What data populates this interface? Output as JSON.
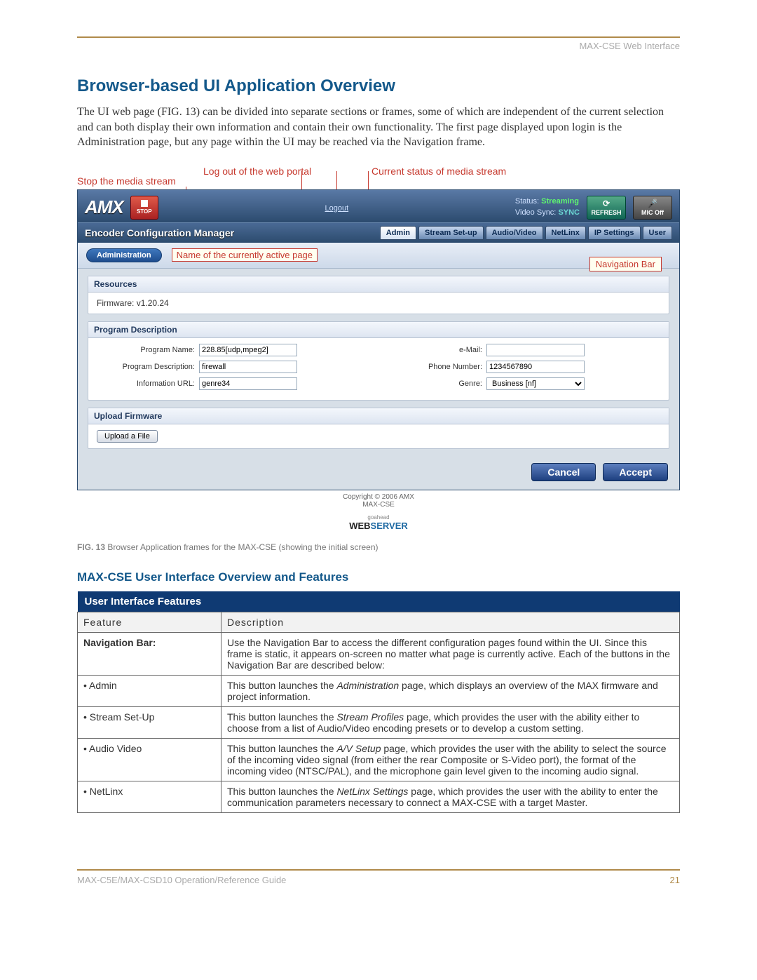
{
  "header_right": "MAX-CSE Web Interface",
  "title": "Browser-based UI Application Overview",
  "body_para": "The UI web page (FIG. 13) can be divided into separate sections or frames, some of which are independent of the current selection and can both display their own information and contain their own functionality. The first page displayed upon login is the Administration page, but any page within the UI may be reached via the Navigation frame.",
  "callouts": {
    "stop": "Stop the media stream",
    "logout": "Log out of the web portal",
    "status": "Current status of media stream",
    "active_page": "Name of the currently active page",
    "navbar": "Navigation Bar"
  },
  "app": {
    "logo": "AMX",
    "stop_label": "STOP",
    "logout_link": "Logout",
    "status": {
      "status_lbl": "Status:",
      "status_val": "Streaming",
      "vsync_lbl": "Video Sync:",
      "vsync_val": "SYNC"
    },
    "refresh_btn": "REFRESH",
    "mic_btn": "MIC Off",
    "ecm_title": "Encoder Configuration Manager",
    "tabs": [
      "Admin",
      "Stream Set-up",
      "Audio/Video",
      "NetLinx",
      "IP Settings",
      "User"
    ],
    "crumb": "Administration",
    "panels": {
      "resources": {
        "title": "Resources",
        "firmware_lbl": "Firmware:",
        "firmware_val": "v1.20.24"
      },
      "program": {
        "title": "Program Description",
        "prog_name_lbl": "Program Name:",
        "prog_name_val": "228.85[udp,mpeg2]",
        "prog_desc_lbl": "Program Description:",
        "prog_desc_val": "firewall",
        "info_url_lbl": "Information URL:",
        "info_url_val": "genre34",
        "email_lbl": "e-Mail:",
        "email_val": "",
        "phone_lbl": "Phone Number:",
        "phone_val": "1234567890",
        "genre_lbl": "Genre:",
        "genre_val": "Business [nf]"
      },
      "upload": {
        "title": "Upload Firmware",
        "button": "Upload a File"
      }
    },
    "cancel": "Cancel",
    "accept": "Accept",
    "copyright": "Copyright © 2006 AMX",
    "copyright2": "MAX-CSE",
    "webserver_tiny": "goahead",
    "webserver1": "WEB",
    "webserver2": "SERVER"
  },
  "fig_caption_bold": "FIG. 13",
  "fig_caption": "Browser Application frames for the MAX-CSE (showing the initial screen)",
  "subhead": "MAX-CSE User Interface Overview and Features",
  "table": {
    "bar": "User Interface Features",
    "col1": "Feature",
    "col2": "Description",
    "rows": [
      {
        "feature": "Navigation Bar:",
        "feature_bold": true,
        "desc": "Use the Navigation Bar to access the different configuration pages found within the UI. Since this frame is static, it appears on-screen no matter what page is currently active. Each of the buttons in the Navigation Bar are described below:"
      },
      {
        "feature": "• Admin",
        "desc_html": "This button launches the <em>Administration</em> page, which displays an overview of the MAX firmware and project information."
      },
      {
        "feature": "• Stream Set-Up",
        "desc_html": "This button launches the <em>Stream Profiles</em> page, which provides the user with the ability either to choose from a list of Audio/Video encoding presets or to develop a custom setting."
      },
      {
        "feature": "• Audio Video",
        "desc_html": "This button launches the <em>A/V Setup</em> page, which provides the user with the ability to select the source of the incoming video signal (from either the rear Composite or S-Video port), the format of the incoming video (NTSC/PAL), and the microphone gain level given to the incoming audio signal."
      },
      {
        "feature": "• NetLinx",
        "desc_html": "This button launches the <em>NetLinx Settings</em> page, which provides the user with the ability to enter the communication parameters necessary to connect a MAX-CSE with a target Master."
      }
    ]
  },
  "footer_left": "MAX-C5E/MAX-CSD10 Operation/Reference Guide",
  "footer_right": "21"
}
